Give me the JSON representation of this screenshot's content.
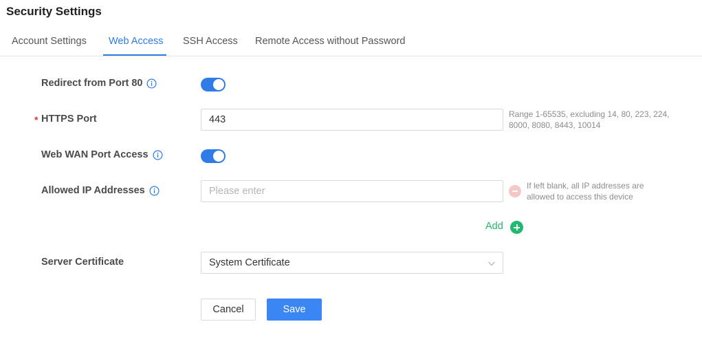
{
  "page": {
    "title": "Security Settings"
  },
  "tabs": [
    {
      "label": "Account Settings",
      "active": false
    },
    {
      "label": "Web Access",
      "active": true
    },
    {
      "label": "SSH Access",
      "active": false
    },
    {
      "label": "Remote Access without Password",
      "active": false
    }
  ],
  "form": {
    "redirect_port80": {
      "label": "Redirect from Port 80",
      "enabled": true
    },
    "https_port": {
      "required_mark": "*",
      "label": "HTTPS Port",
      "value": "443",
      "hint_line1": "Range 1-65535, excluding 14, 80, 223, 224,",
      "hint_line2": "8000, 8080, 8443, 10014"
    },
    "web_wan_access": {
      "label": "Web WAN Port Access",
      "enabled": true
    },
    "allowed_ip": {
      "label": "Allowed IP Addresses",
      "value": "",
      "placeholder": "Please enter",
      "hint_line1": "If left blank, all IP addresses are",
      "hint_line2": "allowed to access this device",
      "add_label": "Add"
    },
    "server_certificate": {
      "label": "Server Certificate",
      "value": "System Certificate"
    }
  },
  "actions": {
    "cancel_label": "Cancel",
    "save_label": "Save"
  },
  "colors": {
    "accent": "#2f7ce6",
    "add_green": "#1fba6f",
    "required_red": "#e0353b",
    "remove_pink": "#f6c7c7"
  },
  "icons": {
    "info": "info-circle-icon",
    "remove": "minus-circle-icon",
    "add": "plus-circle-icon",
    "chevron": "chevron-down-icon"
  }
}
